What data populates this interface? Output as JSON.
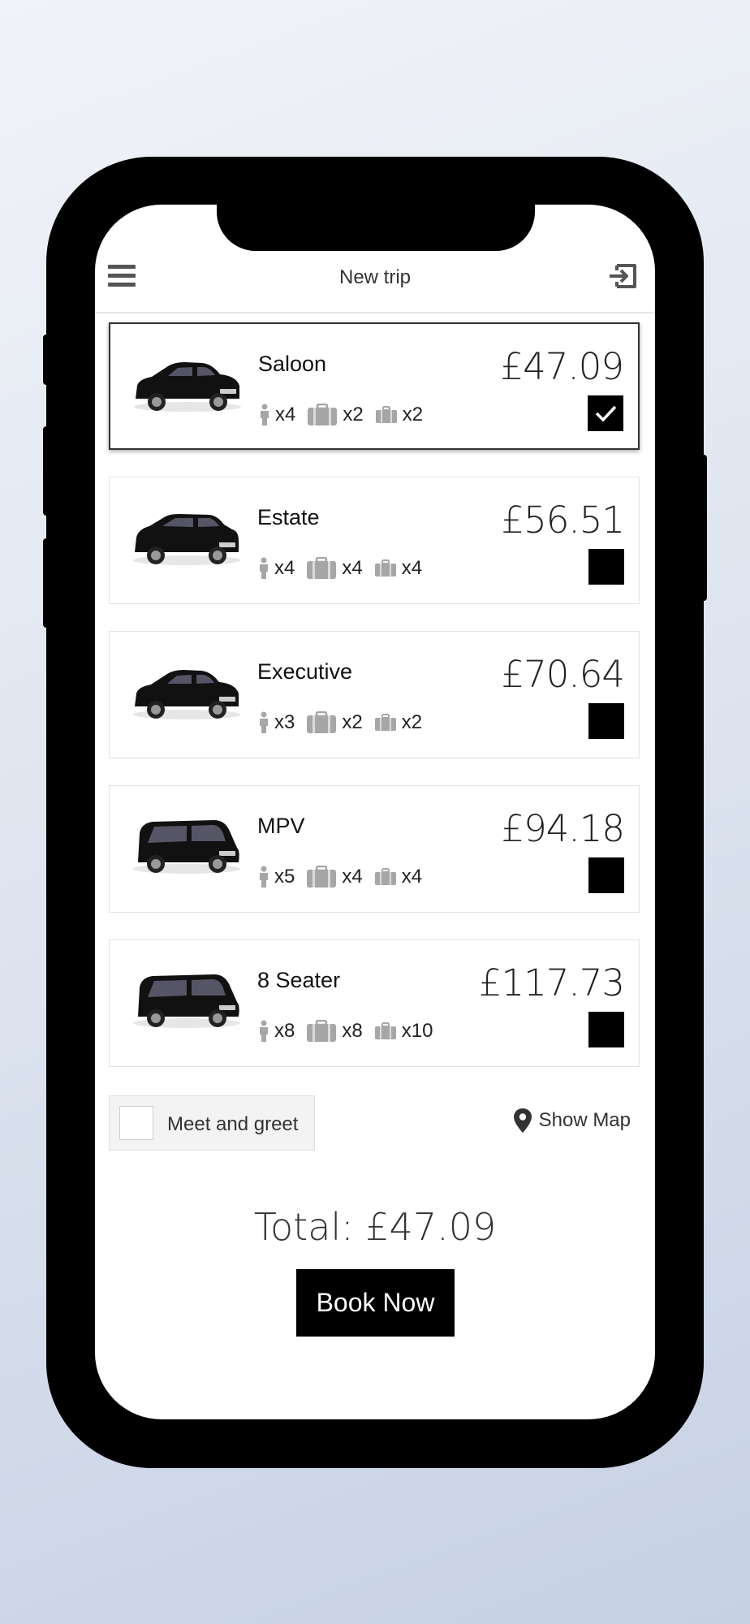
{
  "header": {
    "title": "New trip"
  },
  "vehicles": [
    {
      "name": "Saloon",
      "price": "£47.09",
      "passengers": "x4",
      "large_bags": "x2",
      "small_bags": "x2",
      "selected": true
    },
    {
      "name": "Estate",
      "price": "£56.51",
      "passengers": "x4",
      "large_bags": "x4",
      "small_bags": "x4",
      "selected": false
    },
    {
      "name": "Executive",
      "price": "£70.64",
      "passengers": "x3",
      "large_bags": "x2",
      "small_bags": "x2",
      "selected": false
    },
    {
      "name": "MPV",
      "price": "£94.18",
      "passengers": "x5",
      "large_bags": "x4",
      "small_bags": "x4",
      "selected": false
    },
    {
      "name": "8 Seater",
      "price": "£117.73",
      "passengers": "x8",
      "large_bags": "x8",
      "small_bags": "x10",
      "selected": false
    }
  ],
  "options": {
    "meet_and_greet_label": "Meet and greet",
    "meet_and_greet_checked": false,
    "show_map_label": "Show Map"
  },
  "footer": {
    "total": "Total: £47.09",
    "book_label": "Book Now"
  },
  "colors": {
    "accent": "#000000",
    "icon_grey": "#a6a6a6",
    "background": "#ffffff"
  }
}
